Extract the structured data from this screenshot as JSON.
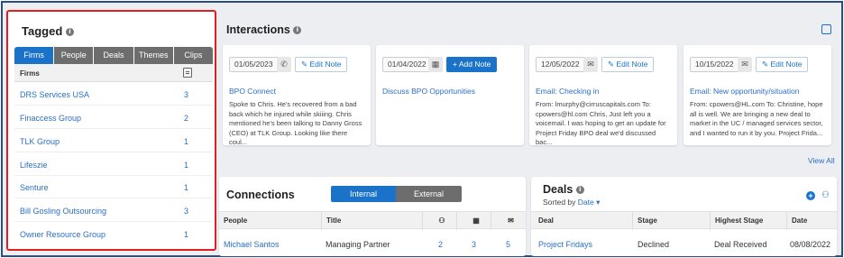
{
  "tagged": {
    "title": "Tagged",
    "tabs": [
      "Firms",
      "People",
      "Deals",
      "Themes",
      "Clips"
    ],
    "active_tab": "Firms",
    "column_header": "Firms",
    "rows": [
      {
        "name": "DRS Services USA",
        "count": "3"
      },
      {
        "name": "Finaccess Group",
        "count": "2"
      },
      {
        "name": "TLK Group",
        "count": "1"
      },
      {
        "name": "Lifeszie",
        "count": "1"
      },
      {
        "name": "Senture",
        "count": "1"
      },
      {
        "name": "Bill Gosling Outsourcing",
        "count": "3"
      },
      {
        "name": "Owner Resource Group",
        "count": "1"
      }
    ]
  },
  "interactions": {
    "title": "Interactions",
    "view_all": "View All",
    "cards": [
      {
        "date": "01/05/2023",
        "type_icon": "phone-icon",
        "action": "Edit Note",
        "title": "BPO Connect",
        "body": "Spoke to Chris. He's recovered from a bad back which he injured while skiiing. Chris mentioned he's been talking to Danny Gross (CEO) at TLK Group. Looking like there coul..."
      },
      {
        "date": "01/04/2022",
        "type_icon": "calendar-icon",
        "action": "+ Add Note",
        "title": "Discuss BPO Opportunities",
        "body": ""
      },
      {
        "date": "12/05/2022",
        "type_icon": "mail-icon",
        "action": "Edit Note",
        "title": "Email: Checking in",
        "body": "From: lmurphy@cirruscapitals.com To: cpowers@hl.com Chris, Just left you a voicemail. I was hoping to get an update for Project Friday BPO deal we'd discussed bac..."
      },
      {
        "date": "10/15/2022",
        "type_icon": "mail-icon",
        "action": "Edit Note",
        "title": "Email: New opportunity/situation",
        "body": "From: cpowers@HL.com To: Christine, hope all is well. We are bringing a new deal to market in the UC / managed services sector, and I wanted to run it by you. Project Frida..."
      }
    ]
  },
  "connections": {
    "title": "Connections",
    "toggle": [
      "Internal",
      "External"
    ],
    "active_toggle": "Internal",
    "columns": [
      "People",
      "Title"
    ],
    "row": {
      "person": "Michael Santos",
      "title": "Managing Partner",
      "c1": "2",
      "c2": "3",
      "c3": "5"
    }
  },
  "deals": {
    "title": "Deals",
    "sorted_by_label": "Sorted by",
    "sorted_by_value": "Date",
    "columns": [
      "Deal",
      "Stage",
      "Highest Stage",
      "Date"
    ],
    "row": {
      "deal": "Project Fridays",
      "stage": "Declined",
      "highest": "Deal Received",
      "date": "08/08/2022"
    }
  },
  "colors": {
    "accent": "#1a73c9",
    "highlight_border": "#e02020",
    "frame_border": "#2b4c8c"
  }
}
